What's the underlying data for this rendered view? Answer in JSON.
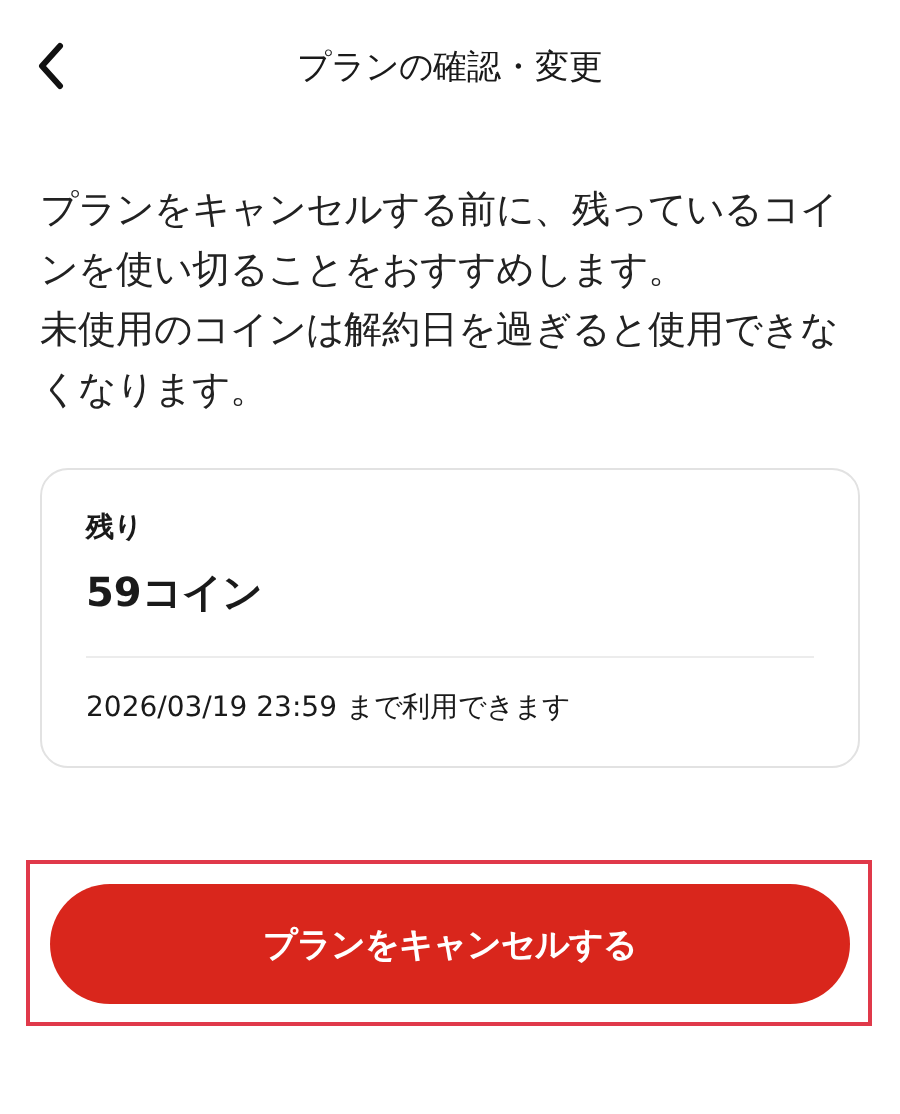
{
  "header": {
    "title": "プランの確認・変更"
  },
  "notice": [
    "プランをキャンセルする前に、残っているコインを使い切ることをおすすめします。",
    "未使用のコインは解約日を過ぎると使用できなくなります。"
  ],
  "balance_card": {
    "label": "残り",
    "amount": "59コイン",
    "expiry": "2026/03/19 23:59 まで利用できます"
  },
  "cancel_button": {
    "label": "プランをキャンセルする"
  }
}
